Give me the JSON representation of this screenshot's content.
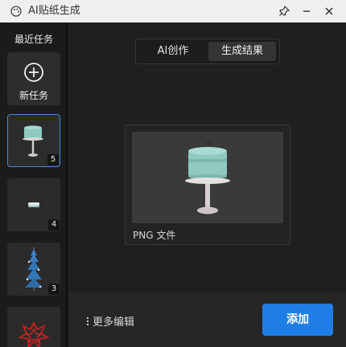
{
  "window": {
    "title": "AI贴纸生成",
    "icons": {
      "app": "palette-icon",
      "pin": "pin-icon",
      "minimize": "minimize-icon",
      "close": "close-icon"
    }
  },
  "sidebar": {
    "title": "最近任务",
    "new_task_label": "新任务",
    "tasks": [
      {
        "count": "5",
        "thumb": "cake-on-stand",
        "active": true
      },
      {
        "count": "4",
        "thumb": "small-cake-slice",
        "active": false
      },
      {
        "count": "3",
        "thumb": "blue-tree",
        "active": false
      },
      {
        "count": "",
        "thumb": "red-pattern",
        "active": false
      }
    ]
  },
  "main": {
    "tabs": [
      {
        "label": "AI创作",
        "active": false
      },
      {
        "label": "生成结果",
        "active": true
      }
    ],
    "result": {
      "file_type": "PNG 文件",
      "image": "teal-cake-on-stand"
    },
    "bottom": {
      "more_edit_label": "更多编辑",
      "add_label": "添加"
    }
  },
  "colors": {
    "accent": "#1e7ee6",
    "selected_border": "#3b8fe0",
    "cake": "#8fc9c1"
  }
}
